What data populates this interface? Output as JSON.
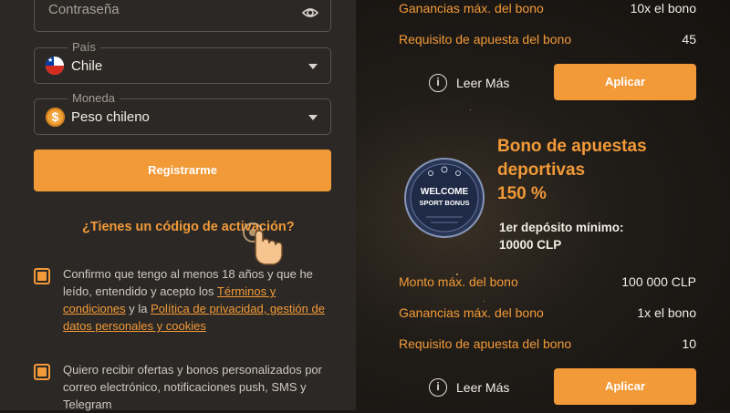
{
  "form": {
    "password": {
      "placeholder": "Contraseña"
    },
    "country": {
      "label": "País",
      "value": "Chile"
    },
    "currency": {
      "label": "Moneda",
      "value": "Peso chileno",
      "symbol": "$"
    },
    "register_label": "Registrarme",
    "activation_link": "¿Tienes un código de activación?",
    "consent": {
      "text_1": "Confirmo que tengo al menos 18 años y que he leído, entendido y acepto los",
      "terms_link": "Términos y condiciones",
      "and": "y la",
      "privacy_link": "Política de privacidad, gestión de datos personales y cookies"
    },
    "marketing": {
      "text": "Quiero recibir ofertas y bonos personalizados por correo electrónico, notificaciones push, SMS y Telegram"
    }
  },
  "bonus_top": {
    "rows": [
      {
        "label": "Ganancias máx. del bono",
        "value": "10x el bono"
      },
      {
        "label": "Requisito de apuesta del bono",
        "value": "45"
      }
    ],
    "read_more": "Leer Más",
    "apply": "Aplicar"
  },
  "bonus_sport": {
    "badge_line1": "WELCOME",
    "badge_line2": "SPORT BONUS",
    "title_line1": "Bono de apuestas",
    "title_line2": "deportivas",
    "title_line3": "150 %",
    "deposit_label": "1er depósito mínimo:",
    "deposit_value": "10000 CLP",
    "rows": [
      {
        "label": "Monto máx. del bono",
        "value": "100 000 CLP"
      },
      {
        "label": "Ganancias máx. del bono",
        "value": "1x el bono"
      },
      {
        "label": "Requisito de apuesta del bono",
        "value": "10"
      }
    ],
    "read_more": "Leer Más",
    "apply": "Aplicar"
  },
  "colors": {
    "accent": "#f29a38",
    "panel": "#2b2825",
    "background": "#1a1714"
  }
}
